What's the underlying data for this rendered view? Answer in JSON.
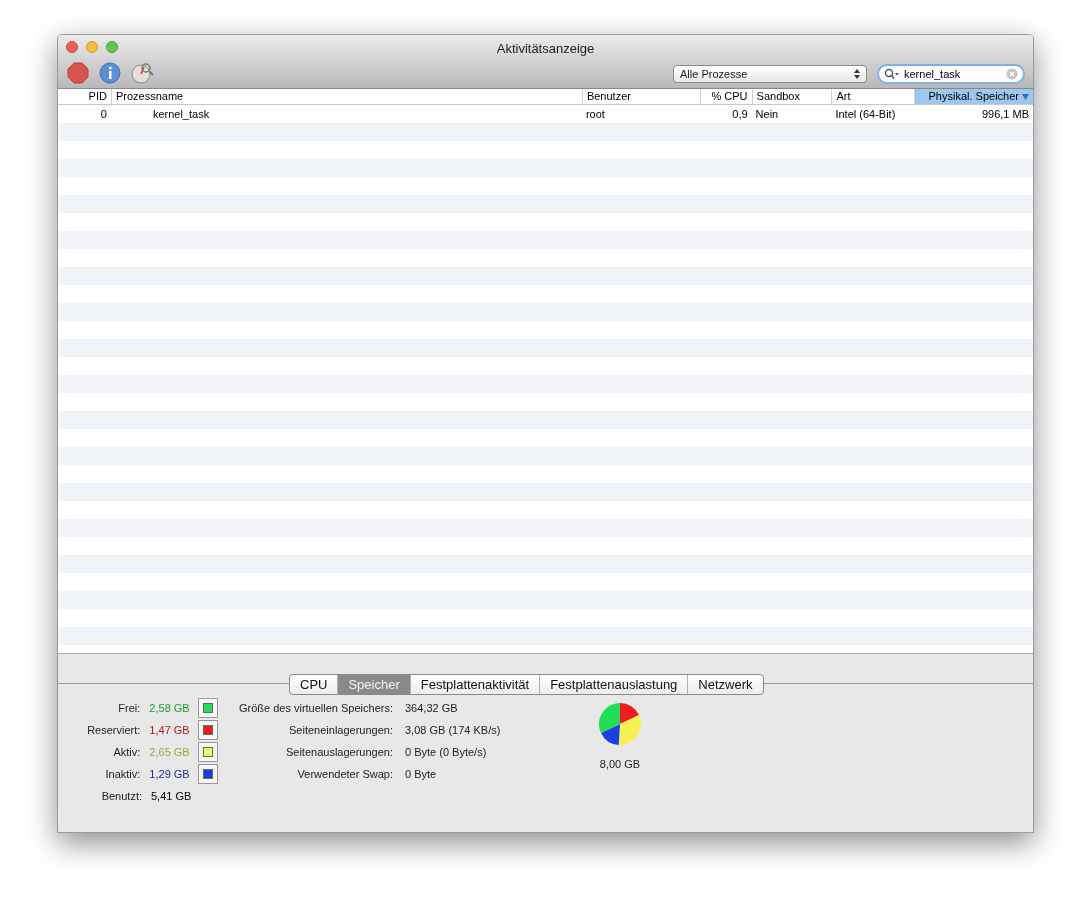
{
  "window": {
    "title": "Aktivitätsanzeige"
  },
  "toolbar": {
    "filter": "Alle Prozesse",
    "search": {
      "value": "kernel_task"
    }
  },
  "table": {
    "columns": [
      {
        "label": "PID",
        "selected": false
      },
      {
        "label": "Prozessname",
        "selected": false
      },
      {
        "label": "Benutzer",
        "selected": false
      },
      {
        "label": "% CPU",
        "selected": false
      },
      {
        "label": "Sandbox",
        "selected": false
      },
      {
        "label": "Art",
        "selected": false
      },
      {
        "label": "Physikal. Speicher",
        "selected": true
      }
    ],
    "rows": [
      [
        "0",
        "kernel_task",
        "root",
        "0,9",
        "Nein",
        "Intel (64-Bit)",
        "996,1 MB"
      ]
    ]
  },
  "tabs": [
    {
      "label": "CPU",
      "selected": false
    },
    {
      "label": "Speicher",
      "selected": true
    },
    {
      "label": "Festplattenaktivität",
      "selected": false
    },
    {
      "label": "Festplattenauslastung",
      "selected": false
    },
    {
      "label": "Netzwerk",
      "selected": false
    }
  ],
  "memory": [
    {
      "label": "Frei:",
      "value": "2,58 GB",
      "color": "#22dd55"
    },
    {
      "label": "Reserviert:",
      "value": "1,47 GB",
      "color": "#ee1c1c"
    },
    {
      "label": "Aktiv:",
      "value": "2,65 GB",
      "color": "#f5f055"
    },
    {
      "label": "Inaktiv:",
      "value": "1,29 GB",
      "color": "#1c3ee0"
    },
    {
      "label": "Benutzt:",
      "value": "5,41 GB"
    }
  ],
  "stats": [
    {
      "label": "Größe des virtuellen Speichers:",
      "value": "364,32 GB"
    },
    {
      "label": "Seiteneinlagerungen:",
      "value": "3,08 GB (174 KB/s)"
    },
    {
      "label": "Seitenauslagerungen:",
      "value": "0 Byte (0 Byte/s)"
    },
    {
      "label": "Verwendeter Swap:",
      "value": "0 Byte"
    }
  ],
  "total": "8,00 GB"
}
